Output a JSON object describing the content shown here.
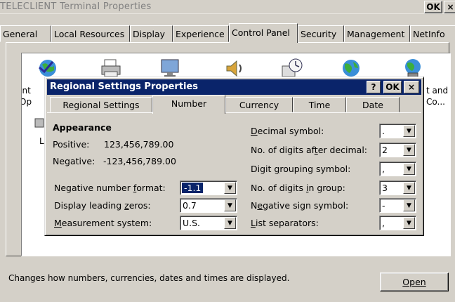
{
  "window": {
    "title": "TELECLIENT Terminal Properties",
    "ok_label": "OK",
    "close_label": "×"
  },
  "main_tabs": [
    "General",
    "Local Resources",
    "Display",
    "Experience",
    "Control Panel",
    "Security",
    "Management",
    "NetInfo"
  ],
  "active_main_tab": "Control Panel",
  "control_panel": {
    "visible_fragments": {
      "left_col_1": "Int",
      "left_col_2": "Op",
      "left_col_3": "L",
      "right_col_1": "t and",
      "right_col_2": "Co..."
    },
    "icons": [
      "internet-options-icon",
      "printer-icon",
      "display-icon",
      "sound-icon",
      "date-time-icon",
      "regional-settings-icon",
      "network-icon"
    ]
  },
  "status_text": "Changes how numbers, currencies, dates and times are displayed.",
  "open_button": "Open",
  "dialog": {
    "title": "Regional Settings Properties",
    "help_label": "?",
    "ok_label": "OK",
    "close_label": "×",
    "tabs": [
      "Regional Settings",
      "Number",
      "Currency",
      "Time",
      "Date"
    ],
    "active_tab": "Number",
    "appearance_heading": "Appearance",
    "positive_label": "Positive:",
    "positive_value": "123,456,789.00",
    "negative_label": "Negative:",
    "negative_value": "-123,456,789.00",
    "fields_left": [
      {
        "label_pre": "Negative number ",
        "label_key": "f",
        "label_post": "ormat:",
        "value": "-1.1"
      },
      {
        "label_pre": "Display leading ",
        "label_key": "z",
        "label_post": "eros:",
        "value": "0.7"
      },
      {
        "label_pre": "",
        "label_key": "M",
        "label_post": "easurement system:",
        "value": "U.S."
      }
    ],
    "fields_right": [
      {
        "label_pre": "",
        "label_key": "D",
        "label_post": "ecimal symbol:",
        "value": "."
      },
      {
        "label_pre": "No. of digits af",
        "label_key": "t",
        "label_post": "er decimal:",
        "value": "2"
      },
      {
        "label_pre": "Digit ",
        "label_key": "g",
        "label_post": "rouping symbol:",
        "value": ","
      },
      {
        "label_pre": "No. of digits ",
        "label_key": "i",
        "label_post": "n group:",
        "value": "3"
      },
      {
        "label_pre": "N",
        "label_key": "e",
        "label_post": "gative sign symbol:",
        "value": "-"
      },
      {
        "label_pre": "",
        "label_key": "L",
        "label_post": "ist separators:",
        "value": ","
      }
    ]
  },
  "colors": {
    "face": "#d4d0c8",
    "active_title": "#0a246a",
    "selection": "#0a246a"
  }
}
